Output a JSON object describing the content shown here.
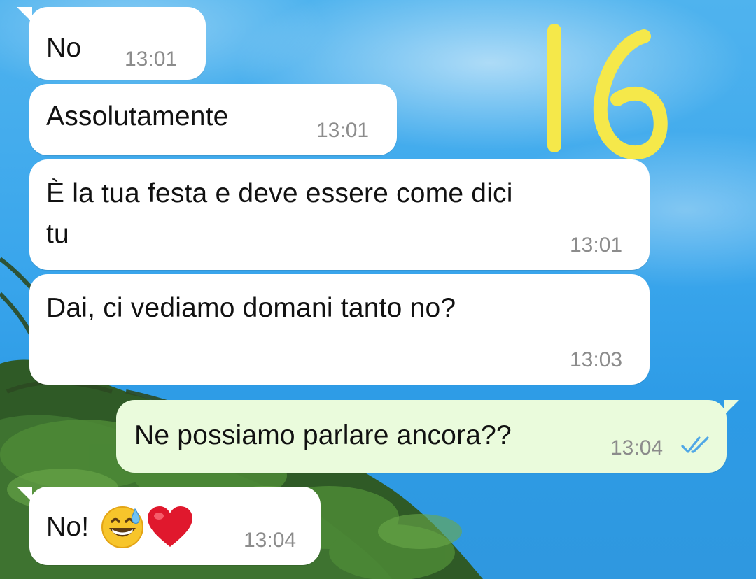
{
  "messages": [
    {
      "direction": "in",
      "text": "No",
      "time": "13:01"
    },
    {
      "direction": "in",
      "text": "Assolutamente",
      "time": "13:01"
    },
    {
      "direction": "in",
      "text": "È la tua festa e deve essere come dici\ntu",
      "time": "13:01"
    },
    {
      "direction": "in",
      "text": "Dai, ci vediamo domani tanto no?",
      "time": "13:03"
    },
    {
      "direction": "out",
      "text": "Ne possiamo parlare ancora??",
      "time": "13:04",
      "status_icon": "double-check-read-icon"
    },
    {
      "direction": "in",
      "text": "No!",
      "time": "13:04",
      "emojis": [
        "grinning-face-with-sweat-icon",
        "red-heart-icon"
      ]
    }
  ],
  "overlay_label": "16",
  "colors": {
    "incoming_bubble": "#ffffff",
    "outgoing_bubble": "#eafbdc",
    "timestamp": "#8c8c8c",
    "read_ticks": "#4fa7e6",
    "overlay_marker": "#f5e84a"
  }
}
